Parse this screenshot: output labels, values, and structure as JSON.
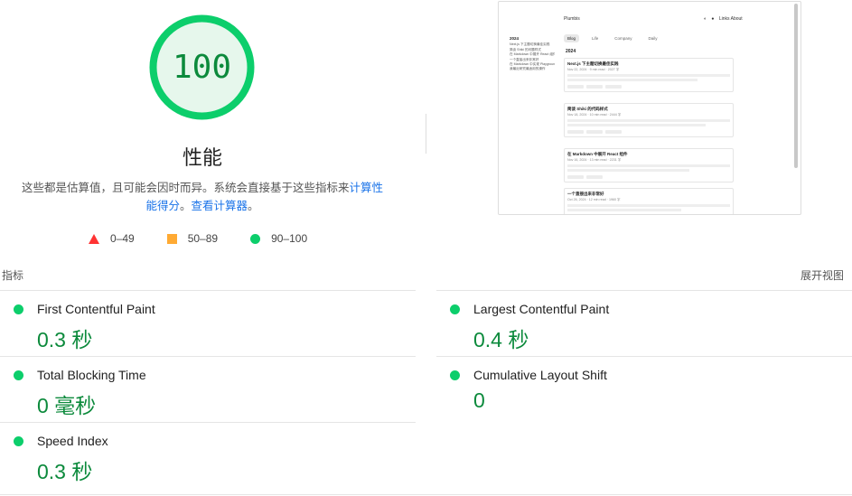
{
  "score": {
    "value": "100",
    "title": "性能",
    "desc_text": "这些都是估算值，且可能会因时而异。系统会直接基于这些指标来",
    "desc_link1": "计算性能得分",
    "desc_sep": "。",
    "desc_link2": "查看计算器",
    "desc_end": "。",
    "color": "#0cce6b"
  },
  "legend": [
    {
      "range": "0–49",
      "shape": "triangle",
      "color": "#ff3333"
    },
    {
      "range": "50–89",
      "shape": "square",
      "color": "#ffaa33"
    },
    {
      "range": "90–100",
      "shape": "circle",
      "color": "#0cce6b"
    }
  ],
  "screenshot": {
    "site_title": "Plumbis",
    "nav": "Links  About",
    "tabs": [
      {
        "label": "Blog",
        "active": true
      },
      {
        "label": "Life",
        "active": false
      },
      {
        "label": "Company",
        "active": false
      },
      {
        "label": "Daily",
        "active": false
      }
    ],
    "year": "2024",
    "sidebar_year": "2024",
    "sidebar_items": [
      "Next.js 下主题切换最佳实践",
      "简谈 Shiki 的问题样式",
      "在 Markdown 中展开 React 组件",
      "一个直接出来非常好",
      "在 Markdown 中实现 Playground",
      "我最近研究最适用的操作"
    ],
    "posts": [
      {
        "title": "Next.js 下主题切换最佳实践",
        "meta": "Nov 22, 2024 · 9 min read · 2027 字"
      },
      {
        "title": "简谈 Shiki 的代码样式",
        "meta": "Nov 18, 2024 · 10 min read · 2444 字"
      },
      {
        "title": "在 Markdown 中展开 React 组件",
        "meta": "Nov 16, 2024 · 13 min read · 2231 字"
      },
      {
        "title": "一个直接出来非常好",
        "meta": "Oct 26, 2024 · 12 min read · 1960 字"
      }
    ]
  },
  "metrics_section": {
    "label": "指标",
    "expand": "展开视图"
  },
  "metrics": [
    {
      "name": "First Contentful Paint",
      "value": "0.3 秒",
      "status": "good"
    },
    {
      "name": "Largest Contentful Paint",
      "value": "0.4 秒",
      "status": "good"
    },
    {
      "name": "Total Blocking Time",
      "value": "0 毫秒",
      "status": "good"
    },
    {
      "name": "Cumulative Layout Shift",
      "value": "0",
      "status": "good"
    },
    {
      "name": "Speed Index",
      "value": "0.3 秒",
      "status": "good"
    }
  ]
}
